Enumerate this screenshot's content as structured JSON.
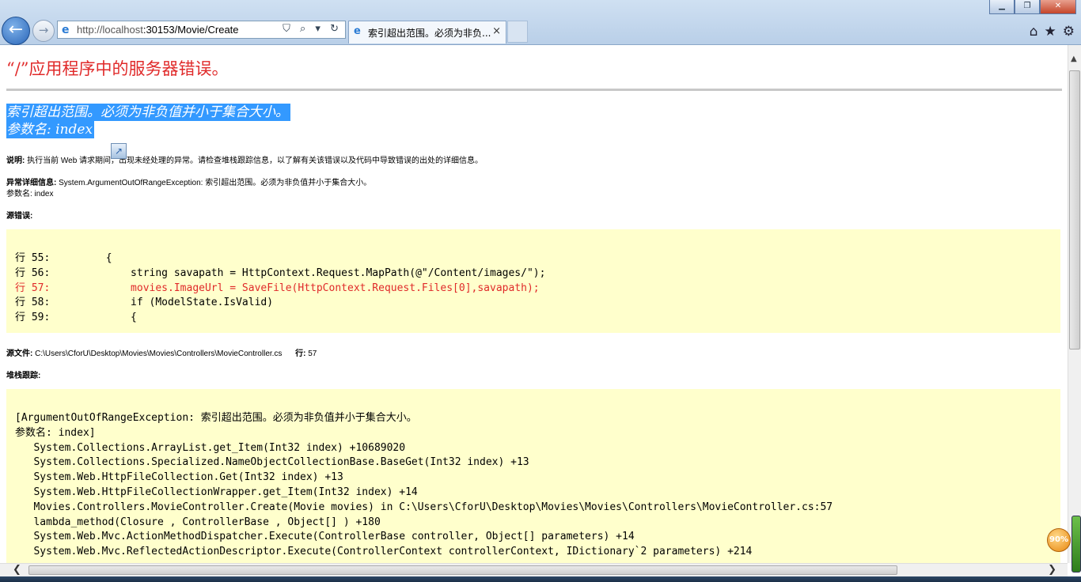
{
  "browser": {
    "url_prefix": "http://localhost",
    "url_rest": ":30153/Movie/Create",
    "tab_title": "索引超出范围。必须为非负...",
    "tab_close": "×",
    "back_glyph": "←",
    "forward_glyph": "→",
    "address_tools": "⛉ ⌕ ▾ ↻",
    "window_buttons": {
      "minimize": "▁",
      "maximize": "❐",
      "close": "✕"
    },
    "right_icons": {
      "home": "⌂",
      "favorites": "★",
      "tools": "⚙"
    }
  },
  "error_page": {
    "title": "“/”应用程序中的服务器错误。",
    "message_line1": "索引超出范围。必须为非负值并小于集合大小。",
    "message_line2": "参数名: index",
    "description_label": "说明:",
    "description_text": "执行当前 Web 请求期间，出现未经处理的异常。请检查堆栈跟踪信息，以了解有关该错误以及代码中导致错误的出处的详细信息。",
    "exception_label": "异常详细信息:",
    "exception_text": "System.ArgumentOutOfRangeException: 索引超出范围。必须为非负值并小于集合大小。",
    "exception_param": "参数名: index",
    "source_error_label": "源错误:",
    "source_lines": [
      {
        "line": "行 55:         {",
        "error": false
      },
      {
        "line": "行 56:             string savapath = HttpContext.Request.MapPath(@\"/Content/images/\");",
        "error": false
      },
      {
        "line": "行 57:             movies.ImageUrl = SaveFile(HttpContext.Request.Files[0],savapath);",
        "error": true
      },
      {
        "line": "行 58:             if (ModelState.IsValid)",
        "error": false
      },
      {
        "line": "行 59:             {",
        "error": false
      }
    ],
    "source_file_label": "源文件:",
    "source_file_path": "C:\\Users\\CforU\\Desktop\\Movies\\Movies\\Controllers\\MovieController.cs",
    "source_line_label": "行:",
    "source_line_number": "57",
    "stack_trace_label": "堆栈跟踪:",
    "stack_trace": [
      "[ArgumentOutOfRangeException: 索引超出范围。必须为非负值并小于集合大小。",
      "参数名: index]",
      "   System.Collections.ArrayList.get_Item(Int32 index) +10689020",
      "   System.Collections.Specialized.NameObjectCollectionBase.BaseGet(Int32 index) +13",
      "   System.Web.HttpFileCollection.Get(Int32 index) +13",
      "   System.Web.HttpFileCollectionWrapper.get_Item(Int32 index) +14",
      "   Movies.Controllers.MovieController.Create(Movie movies) in C:\\Users\\CforU\\Desktop\\Movies\\Movies\\Controllers\\MovieController.cs:57",
      "   lambda_method(Closure , ControllerBase , Object[] ) +180",
      "   System.Web.Mvc.ActionMethodDispatcher.Execute(ControllerBase controller, Object[] parameters) +14",
      "   System.Web.Mvc.ReflectedActionDescriptor.Execute(ControllerContext controllerContext, IDictionary`2 parameters) +214"
    ]
  },
  "zoom_badge": "90%",
  "colors": {
    "error_red": "#e02a2a",
    "code_bg": "#ffffcc",
    "selection": "#3399ff"
  }
}
